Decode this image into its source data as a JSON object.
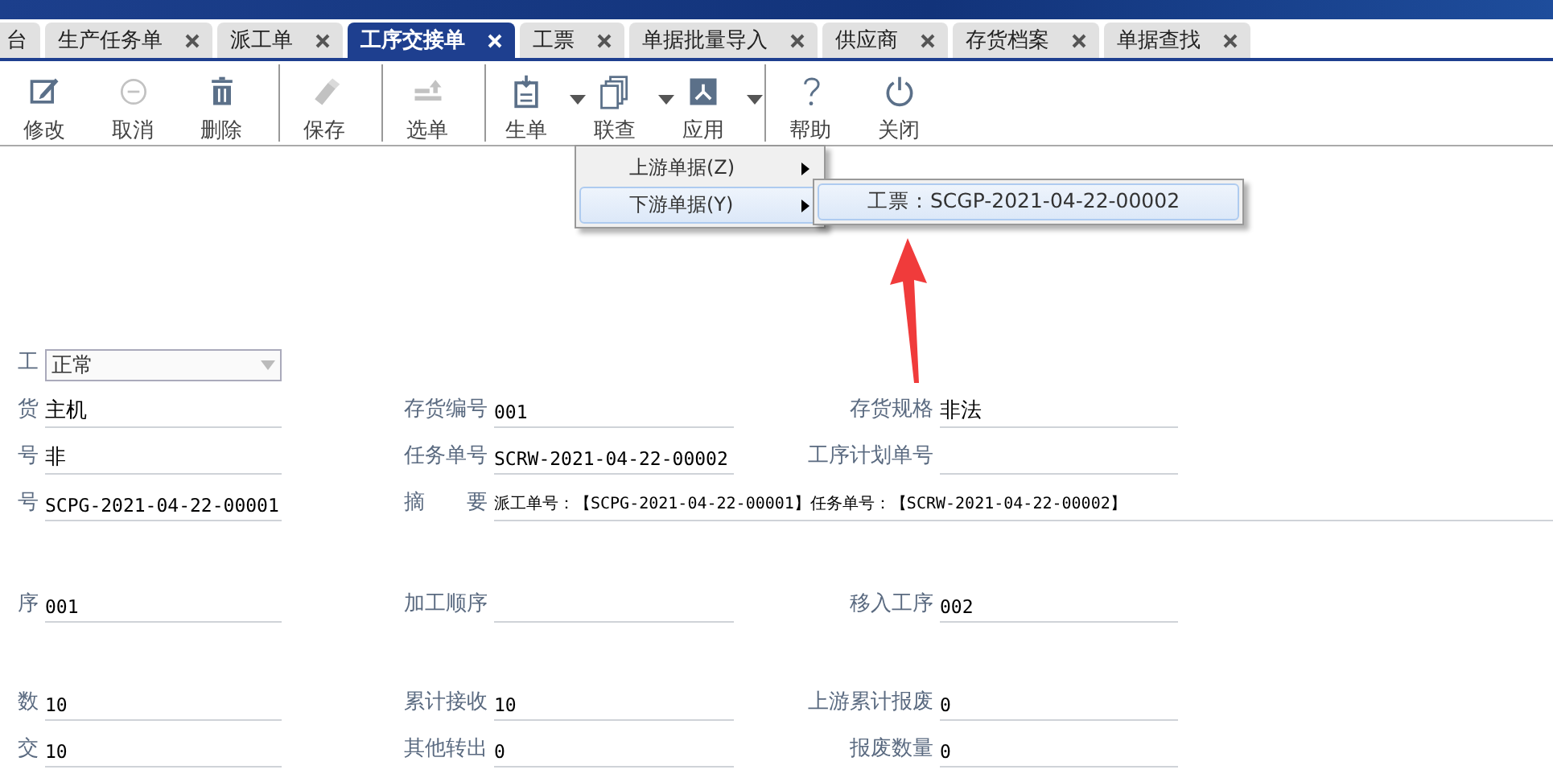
{
  "tabs": [
    {
      "label": "台",
      "closable": false,
      "selected": false
    },
    {
      "label": "生产任务单",
      "closable": true,
      "selected": false
    },
    {
      "label": "派工单",
      "closable": true,
      "selected": false
    },
    {
      "label": "工序交接单",
      "closable": true,
      "selected": true
    },
    {
      "label": "工票",
      "closable": true,
      "selected": false
    },
    {
      "label": "单据批量导入",
      "closable": true,
      "selected": false
    },
    {
      "label": "供应商",
      "closable": true,
      "selected": false
    },
    {
      "label": "存货档案",
      "closable": true,
      "selected": false
    },
    {
      "label": "单据查找",
      "closable": true,
      "selected": false
    }
  ],
  "toolbar": [
    [
      {
        "label": "修改",
        "disabled": false,
        "dropdown": false
      },
      {
        "label": "取消",
        "disabled": true,
        "dropdown": false
      },
      {
        "label": "删除",
        "disabled": false,
        "dropdown": false
      }
    ],
    [
      {
        "label": "保存",
        "disabled": true,
        "dropdown": false
      }
    ],
    [
      {
        "label": "选单",
        "disabled": true,
        "dropdown": false
      }
    ],
    [
      {
        "label": "生单",
        "disabled": false,
        "dropdown": true
      },
      {
        "label": "联查",
        "disabled": false,
        "dropdown": true
      },
      {
        "label": "应用",
        "disabled": false,
        "dropdown": true
      }
    ],
    [
      {
        "label": "帮助",
        "disabled": false,
        "dropdown": false
      },
      {
        "label": "关闭",
        "disabled": false,
        "dropdown": false
      }
    ]
  ],
  "menu": {
    "items": [
      {
        "label": "上游单据(Z)",
        "selected": false
      },
      {
        "label": "下游单据(Y)",
        "selected": true
      }
    ],
    "submenu": [
      {
        "label": "工票：SCGP-2021-04-22-00002",
        "selected": true
      }
    ]
  },
  "form": [
    [
      {
        "kind": "select",
        "label": "工",
        "value": "正常",
        "disabled": true
      }
    ],
    [
      {
        "kind": "text",
        "label": "货",
        "value": "主机"
      },
      {
        "kind": "text",
        "label": "存货编号",
        "value": "001"
      },
      {
        "kind": "text",
        "label": "存货规格",
        "value": "非法"
      }
    ],
    [
      {
        "kind": "text",
        "label": "号",
        "value": "非"
      },
      {
        "kind": "text",
        "label": "任务单号",
        "value": "SCRW-2021-04-22-00002"
      },
      {
        "kind": "text",
        "label": "工序计划单号"
      }
    ],
    [
      {
        "kind": "text",
        "label": "号",
        "value": "SCPG-2021-04-22-00001"
      },
      {
        "kind": "wide",
        "label": "摘　　要",
        "value": "派工单号：【SCPG-2021-04-22-00001】任务单号：【SCRW-2021-04-22-00002】"
      }
    ],
    [
      {
        "kind": "text",
        "label": "序",
        "value": "001"
      },
      {
        "kind": "text",
        "label": "加工顺序"
      },
      {
        "kind": "text",
        "label": "移入工序",
        "value": "002"
      }
    ],
    [
      {
        "kind": "text",
        "label": "数",
        "value": "10"
      },
      {
        "kind": "text",
        "label": "累计接收",
        "value": "10"
      },
      {
        "kind": "text",
        "label": "上游累计报废",
        "value": "0"
      }
    ],
    [
      {
        "kind": "text",
        "label": "交",
        "value": "10"
      },
      {
        "kind": "text",
        "label": "其他转出",
        "value": "0"
      },
      {
        "kind": "text",
        "label": "报废数量",
        "value": "0"
      }
    ]
  ]
}
